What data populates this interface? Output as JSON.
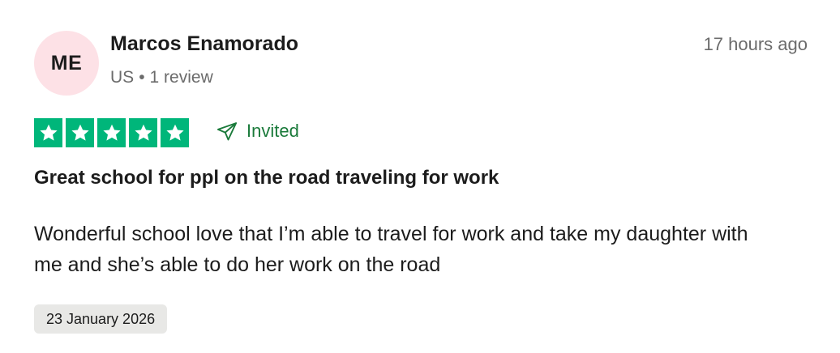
{
  "reviewer": {
    "initials": "ME",
    "name": "Marcos Enamorado",
    "country": "US",
    "separator": "•",
    "review_count": "1 review"
  },
  "timestamp": "17 hours ago",
  "rating": {
    "stars": 5,
    "max": 5,
    "color": "#00b67a",
    "icon": "star-icon"
  },
  "invited": {
    "label": "Invited",
    "icon": "paper-plane-icon",
    "color": "#1a7a3a"
  },
  "review": {
    "title": "Great school for ppl on the road traveling for work",
    "body": "Wonderful school love that I’m able to travel for work and take my daughter with me and she’s able to do her work on the road"
  },
  "experience_date": "23 January 2026",
  "avatar_color": "#fde1e6"
}
